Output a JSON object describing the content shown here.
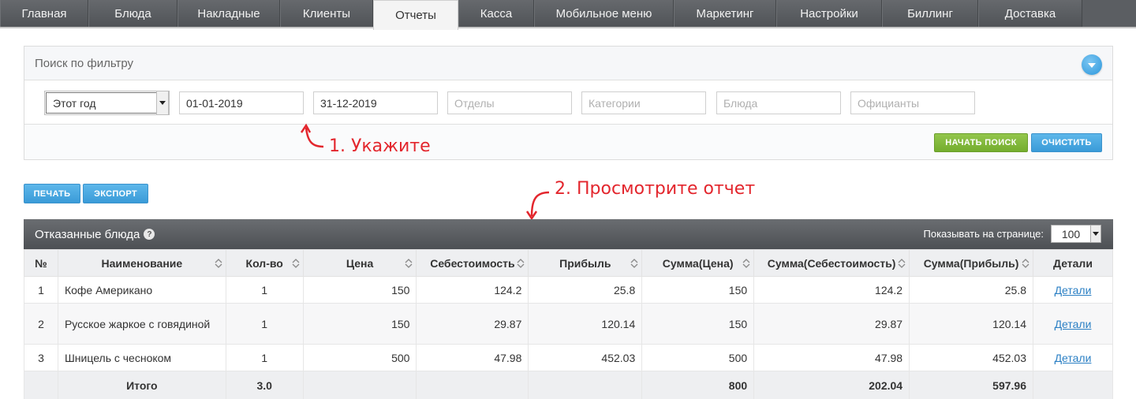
{
  "nav": {
    "tabs": [
      {
        "label": "Главная"
      },
      {
        "label": "Блюда"
      },
      {
        "label": "Накладные"
      },
      {
        "label": "Клиенты"
      },
      {
        "label": "Отчеты",
        "active": true
      },
      {
        "label": "Касса"
      },
      {
        "label": "Мобильное меню"
      },
      {
        "label": "Маркетинг"
      },
      {
        "label": "Настройки"
      },
      {
        "label": "Биллинг"
      },
      {
        "label": "Доставка"
      }
    ]
  },
  "filter": {
    "title": "Поиск по фильтру",
    "period": "Этот год",
    "date_from": "01-01-2019",
    "date_to": "31-12-2019",
    "departments_placeholder": "Отделы",
    "categories_placeholder": "Категории",
    "dishes_placeholder": "Блюда",
    "waiters_placeholder": "Официанты",
    "search_label": "НАЧАТЬ ПОИСК",
    "clear_label": "ОЧИСТИТЬ"
  },
  "annotations": {
    "step1": "1. Укажите",
    "step2": "2. Просмотрите отчет"
  },
  "actions": {
    "print_label": "ПЕЧАТЬ",
    "export_label": "ЭКСПОРТ"
  },
  "report": {
    "title": "Отказанные блюда",
    "per_page_label": "Показывать на странице:",
    "per_page": "100",
    "columns": [
      "№",
      "Наименование",
      "Кол-во",
      "Цена",
      "Себестоимость",
      "Прибыль",
      "Сумма(Цена)",
      "Сумма(Себестоимость)",
      "Сумма(Прибыль)",
      "Детали"
    ],
    "rows": [
      {
        "n": "1",
        "name": "Кофе Американо",
        "qty": "1",
        "price": "150",
        "cost": "124.2",
        "profit": "25.8",
        "sum_price": "150",
        "sum_cost": "124.2",
        "sum_profit": "25.8",
        "details": "Детали"
      },
      {
        "n": "2",
        "name": "Русское жаркое с говядиной",
        "qty": "1",
        "price": "150",
        "cost": "29.87",
        "profit": "120.14",
        "sum_price": "150",
        "sum_cost": "29.87",
        "sum_profit": "120.14",
        "details": "Детали"
      },
      {
        "n": "3",
        "name": "Шницель с чесноком",
        "qty": "1",
        "price": "500",
        "cost": "47.98",
        "profit": "452.03",
        "sum_price": "500",
        "sum_cost": "47.98",
        "sum_profit": "452.03",
        "details": "Детали"
      }
    ],
    "total": {
      "label": "Итого",
      "qty": "3.0",
      "sum_price": "800",
      "sum_cost": "202.04",
      "sum_profit": "597.96"
    }
  },
  "colors": {
    "accent_blue": "#3a9bd8",
    "accent_green": "#74ad2e",
    "annotation_red": "#e3262d"
  }
}
